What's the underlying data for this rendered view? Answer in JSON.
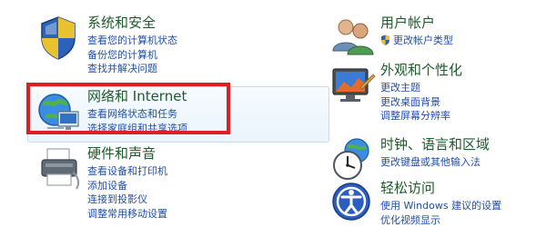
{
  "categories": {
    "system_security": {
      "title": "系统和安全",
      "links": [
        "查看您的计算机状态",
        "备份您的计算机",
        "查找并解决问题"
      ]
    },
    "network": {
      "title": "网络和 Internet",
      "links": [
        "查看网络状态和任务",
        "选择家庭组和共享选项"
      ]
    },
    "hardware": {
      "title": "硬件和声音",
      "links": [
        "查看设备和打印机",
        "添加设备",
        "连接到投影仪",
        "调整常用移动设置"
      ]
    },
    "user_accounts": {
      "title": "用户帐户",
      "links": [
        "更改帐户类型"
      ]
    },
    "appearance": {
      "title": "外观和个性化",
      "links": [
        "更改主题",
        "更改桌面背景",
        "调整屏幕分辨率"
      ]
    },
    "clock": {
      "title": "时钟、语言和区域",
      "links": [
        "更改键盘或其他输入法"
      ]
    },
    "ease": {
      "title": "轻松访问",
      "links": [
        "使用 Windows 建议的设置",
        "优化视频显示"
      ]
    }
  },
  "colors": {
    "title": "#1e5a2a",
    "link": "#1f4fa8",
    "highlight_border": "#e01d22"
  }
}
